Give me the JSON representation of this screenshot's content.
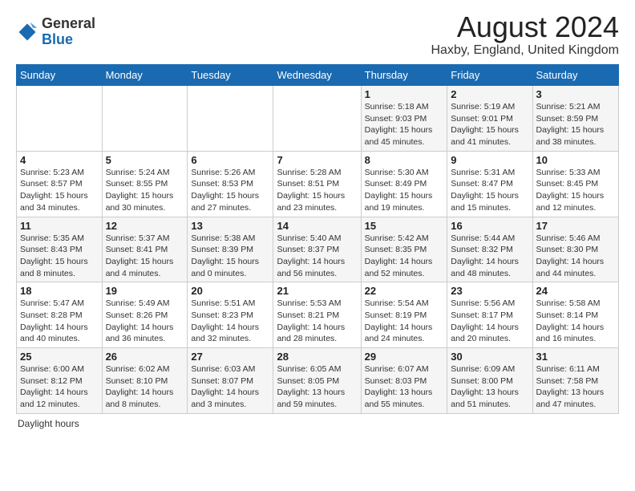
{
  "logo": {
    "general": "General",
    "blue": "Blue"
  },
  "title": "August 2024",
  "location": "Haxby, England, United Kingdom",
  "days_of_week": [
    "Sunday",
    "Monday",
    "Tuesday",
    "Wednesday",
    "Thursday",
    "Friday",
    "Saturday"
  ],
  "footer": "Daylight hours",
  "weeks": [
    [
      {
        "day": "",
        "info": ""
      },
      {
        "day": "",
        "info": ""
      },
      {
        "day": "",
        "info": ""
      },
      {
        "day": "",
        "info": ""
      },
      {
        "day": "1",
        "info": "Sunrise: 5:18 AM\nSunset: 9:03 PM\nDaylight: 15 hours\nand 45 minutes."
      },
      {
        "day": "2",
        "info": "Sunrise: 5:19 AM\nSunset: 9:01 PM\nDaylight: 15 hours\nand 41 minutes."
      },
      {
        "day": "3",
        "info": "Sunrise: 5:21 AM\nSunset: 8:59 PM\nDaylight: 15 hours\nand 38 minutes."
      }
    ],
    [
      {
        "day": "4",
        "info": "Sunrise: 5:23 AM\nSunset: 8:57 PM\nDaylight: 15 hours\nand 34 minutes."
      },
      {
        "day": "5",
        "info": "Sunrise: 5:24 AM\nSunset: 8:55 PM\nDaylight: 15 hours\nand 30 minutes."
      },
      {
        "day": "6",
        "info": "Sunrise: 5:26 AM\nSunset: 8:53 PM\nDaylight: 15 hours\nand 27 minutes."
      },
      {
        "day": "7",
        "info": "Sunrise: 5:28 AM\nSunset: 8:51 PM\nDaylight: 15 hours\nand 23 minutes."
      },
      {
        "day": "8",
        "info": "Sunrise: 5:30 AM\nSunset: 8:49 PM\nDaylight: 15 hours\nand 19 minutes."
      },
      {
        "day": "9",
        "info": "Sunrise: 5:31 AM\nSunset: 8:47 PM\nDaylight: 15 hours\nand 15 minutes."
      },
      {
        "day": "10",
        "info": "Sunrise: 5:33 AM\nSunset: 8:45 PM\nDaylight: 15 hours\nand 12 minutes."
      }
    ],
    [
      {
        "day": "11",
        "info": "Sunrise: 5:35 AM\nSunset: 8:43 PM\nDaylight: 15 hours\nand 8 minutes."
      },
      {
        "day": "12",
        "info": "Sunrise: 5:37 AM\nSunset: 8:41 PM\nDaylight: 15 hours\nand 4 minutes."
      },
      {
        "day": "13",
        "info": "Sunrise: 5:38 AM\nSunset: 8:39 PM\nDaylight: 15 hours\nand 0 minutes."
      },
      {
        "day": "14",
        "info": "Sunrise: 5:40 AM\nSunset: 8:37 PM\nDaylight: 14 hours\nand 56 minutes."
      },
      {
        "day": "15",
        "info": "Sunrise: 5:42 AM\nSunset: 8:35 PM\nDaylight: 14 hours\nand 52 minutes."
      },
      {
        "day": "16",
        "info": "Sunrise: 5:44 AM\nSunset: 8:32 PM\nDaylight: 14 hours\nand 48 minutes."
      },
      {
        "day": "17",
        "info": "Sunrise: 5:46 AM\nSunset: 8:30 PM\nDaylight: 14 hours\nand 44 minutes."
      }
    ],
    [
      {
        "day": "18",
        "info": "Sunrise: 5:47 AM\nSunset: 8:28 PM\nDaylight: 14 hours\nand 40 minutes."
      },
      {
        "day": "19",
        "info": "Sunrise: 5:49 AM\nSunset: 8:26 PM\nDaylight: 14 hours\nand 36 minutes."
      },
      {
        "day": "20",
        "info": "Sunrise: 5:51 AM\nSunset: 8:23 PM\nDaylight: 14 hours\nand 32 minutes."
      },
      {
        "day": "21",
        "info": "Sunrise: 5:53 AM\nSunset: 8:21 PM\nDaylight: 14 hours\nand 28 minutes."
      },
      {
        "day": "22",
        "info": "Sunrise: 5:54 AM\nSunset: 8:19 PM\nDaylight: 14 hours\nand 24 minutes."
      },
      {
        "day": "23",
        "info": "Sunrise: 5:56 AM\nSunset: 8:17 PM\nDaylight: 14 hours\nand 20 minutes."
      },
      {
        "day": "24",
        "info": "Sunrise: 5:58 AM\nSunset: 8:14 PM\nDaylight: 14 hours\nand 16 minutes."
      }
    ],
    [
      {
        "day": "25",
        "info": "Sunrise: 6:00 AM\nSunset: 8:12 PM\nDaylight: 14 hours\nand 12 minutes."
      },
      {
        "day": "26",
        "info": "Sunrise: 6:02 AM\nSunset: 8:10 PM\nDaylight: 14 hours\nand 8 minutes."
      },
      {
        "day": "27",
        "info": "Sunrise: 6:03 AM\nSunset: 8:07 PM\nDaylight: 14 hours\nand 3 minutes."
      },
      {
        "day": "28",
        "info": "Sunrise: 6:05 AM\nSunset: 8:05 PM\nDaylight: 13 hours\nand 59 minutes."
      },
      {
        "day": "29",
        "info": "Sunrise: 6:07 AM\nSunset: 8:03 PM\nDaylight: 13 hours\nand 55 minutes."
      },
      {
        "day": "30",
        "info": "Sunrise: 6:09 AM\nSunset: 8:00 PM\nDaylight: 13 hours\nand 51 minutes."
      },
      {
        "day": "31",
        "info": "Sunrise: 6:11 AM\nSunset: 7:58 PM\nDaylight: 13 hours\nand 47 minutes."
      }
    ]
  ]
}
